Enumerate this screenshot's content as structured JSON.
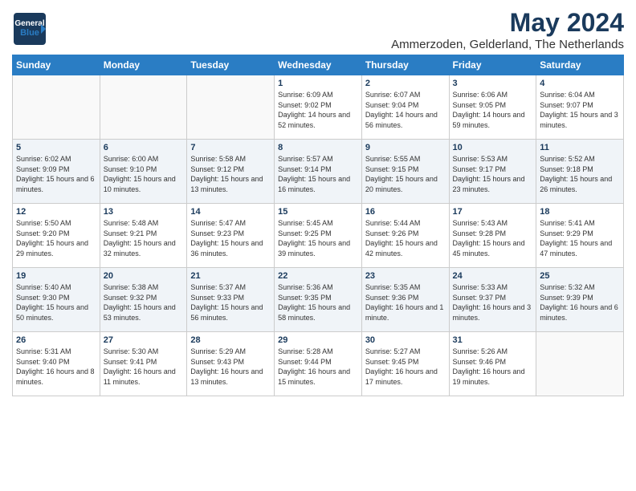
{
  "header": {
    "logo_line1": "General",
    "logo_line2": "Blue",
    "month": "May 2024",
    "location": "Ammerzoden, Gelderland, The Netherlands"
  },
  "weekdays": [
    "Sunday",
    "Monday",
    "Tuesday",
    "Wednesday",
    "Thursday",
    "Friday",
    "Saturday"
  ],
  "weeks": [
    [
      {
        "day": "",
        "info": ""
      },
      {
        "day": "",
        "info": ""
      },
      {
        "day": "",
        "info": ""
      },
      {
        "day": "1",
        "info": "Sunrise: 6:09 AM\nSunset: 9:02 PM\nDaylight: 14 hours and 52 minutes."
      },
      {
        "day": "2",
        "info": "Sunrise: 6:07 AM\nSunset: 9:04 PM\nDaylight: 14 hours and 56 minutes."
      },
      {
        "day": "3",
        "info": "Sunrise: 6:06 AM\nSunset: 9:05 PM\nDaylight: 14 hours and 59 minutes."
      },
      {
        "day": "4",
        "info": "Sunrise: 6:04 AM\nSunset: 9:07 PM\nDaylight: 15 hours and 3 minutes."
      }
    ],
    [
      {
        "day": "5",
        "info": "Sunrise: 6:02 AM\nSunset: 9:09 PM\nDaylight: 15 hours and 6 minutes."
      },
      {
        "day": "6",
        "info": "Sunrise: 6:00 AM\nSunset: 9:10 PM\nDaylight: 15 hours and 10 minutes."
      },
      {
        "day": "7",
        "info": "Sunrise: 5:58 AM\nSunset: 9:12 PM\nDaylight: 15 hours and 13 minutes."
      },
      {
        "day": "8",
        "info": "Sunrise: 5:57 AM\nSunset: 9:14 PM\nDaylight: 15 hours and 16 minutes."
      },
      {
        "day": "9",
        "info": "Sunrise: 5:55 AM\nSunset: 9:15 PM\nDaylight: 15 hours and 20 minutes."
      },
      {
        "day": "10",
        "info": "Sunrise: 5:53 AM\nSunset: 9:17 PM\nDaylight: 15 hours and 23 minutes."
      },
      {
        "day": "11",
        "info": "Sunrise: 5:52 AM\nSunset: 9:18 PM\nDaylight: 15 hours and 26 minutes."
      }
    ],
    [
      {
        "day": "12",
        "info": "Sunrise: 5:50 AM\nSunset: 9:20 PM\nDaylight: 15 hours and 29 minutes."
      },
      {
        "day": "13",
        "info": "Sunrise: 5:48 AM\nSunset: 9:21 PM\nDaylight: 15 hours and 32 minutes."
      },
      {
        "day": "14",
        "info": "Sunrise: 5:47 AM\nSunset: 9:23 PM\nDaylight: 15 hours and 36 minutes."
      },
      {
        "day": "15",
        "info": "Sunrise: 5:45 AM\nSunset: 9:25 PM\nDaylight: 15 hours and 39 minutes."
      },
      {
        "day": "16",
        "info": "Sunrise: 5:44 AM\nSunset: 9:26 PM\nDaylight: 15 hours and 42 minutes."
      },
      {
        "day": "17",
        "info": "Sunrise: 5:43 AM\nSunset: 9:28 PM\nDaylight: 15 hours and 45 minutes."
      },
      {
        "day": "18",
        "info": "Sunrise: 5:41 AM\nSunset: 9:29 PM\nDaylight: 15 hours and 47 minutes."
      }
    ],
    [
      {
        "day": "19",
        "info": "Sunrise: 5:40 AM\nSunset: 9:30 PM\nDaylight: 15 hours and 50 minutes."
      },
      {
        "day": "20",
        "info": "Sunrise: 5:38 AM\nSunset: 9:32 PM\nDaylight: 15 hours and 53 minutes."
      },
      {
        "day": "21",
        "info": "Sunrise: 5:37 AM\nSunset: 9:33 PM\nDaylight: 15 hours and 56 minutes."
      },
      {
        "day": "22",
        "info": "Sunrise: 5:36 AM\nSunset: 9:35 PM\nDaylight: 15 hours and 58 minutes."
      },
      {
        "day": "23",
        "info": "Sunrise: 5:35 AM\nSunset: 9:36 PM\nDaylight: 16 hours and 1 minute."
      },
      {
        "day": "24",
        "info": "Sunrise: 5:33 AM\nSunset: 9:37 PM\nDaylight: 16 hours and 3 minutes."
      },
      {
        "day": "25",
        "info": "Sunrise: 5:32 AM\nSunset: 9:39 PM\nDaylight: 16 hours and 6 minutes."
      }
    ],
    [
      {
        "day": "26",
        "info": "Sunrise: 5:31 AM\nSunset: 9:40 PM\nDaylight: 16 hours and 8 minutes."
      },
      {
        "day": "27",
        "info": "Sunrise: 5:30 AM\nSunset: 9:41 PM\nDaylight: 16 hours and 11 minutes."
      },
      {
        "day": "28",
        "info": "Sunrise: 5:29 AM\nSunset: 9:43 PM\nDaylight: 16 hours and 13 minutes."
      },
      {
        "day": "29",
        "info": "Sunrise: 5:28 AM\nSunset: 9:44 PM\nDaylight: 16 hours and 15 minutes."
      },
      {
        "day": "30",
        "info": "Sunrise: 5:27 AM\nSunset: 9:45 PM\nDaylight: 16 hours and 17 minutes."
      },
      {
        "day": "31",
        "info": "Sunrise: 5:26 AM\nSunset: 9:46 PM\nDaylight: 16 hours and 19 minutes."
      },
      {
        "day": "",
        "info": ""
      }
    ]
  ]
}
